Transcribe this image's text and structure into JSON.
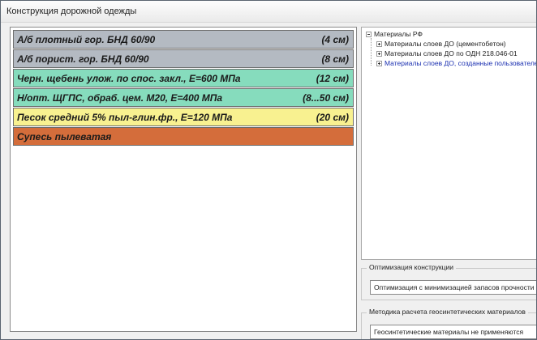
{
  "window": {
    "title": "Конструкция дорожной одежды"
  },
  "layers": [
    {
      "name": "А/б плотный гор. БНД 60/90",
      "thickness": "(4 см)",
      "color": "#b4bac2"
    },
    {
      "name": "А/б порист. гор. БНД 60/90",
      "thickness": "(8 см)",
      "color": "#b4bac2"
    },
    {
      "name": "Черн. щебень улож. по спос. закл., Е=600 МПа",
      "thickness": "(12 см)",
      "color": "#86dcbd"
    },
    {
      "name": "Н/опт. ЩГПС, обраб. цем. М20, Е=400 МПа",
      "thickness": "(8...50 см)",
      "color": "#86dcbd"
    },
    {
      "name": "Песок средний 5% пыл-глин.фр., Е=120 МПа",
      "thickness": "(20 см)",
      "color": "#f8f190"
    },
    {
      "name": "Супесь пылеватая",
      "thickness": "",
      "color": "#d46d3b"
    }
  ],
  "materials_tree": {
    "root": "Материалы РФ",
    "children": [
      "Материалы слоев ДО (цементобетон)",
      "Материалы слоев ДО по ОДН 218.046-01",
      "Материалы слоев ДО, созданные пользователем"
    ]
  },
  "optimization": {
    "label": "Оптимизация конструкции",
    "value": "Оптимизация с минимизацией запасов прочности"
  },
  "geosynthetics": {
    "label": "Методика расчета геосинтетических материалов",
    "value": "Геосинтетические материалы не применяются"
  }
}
